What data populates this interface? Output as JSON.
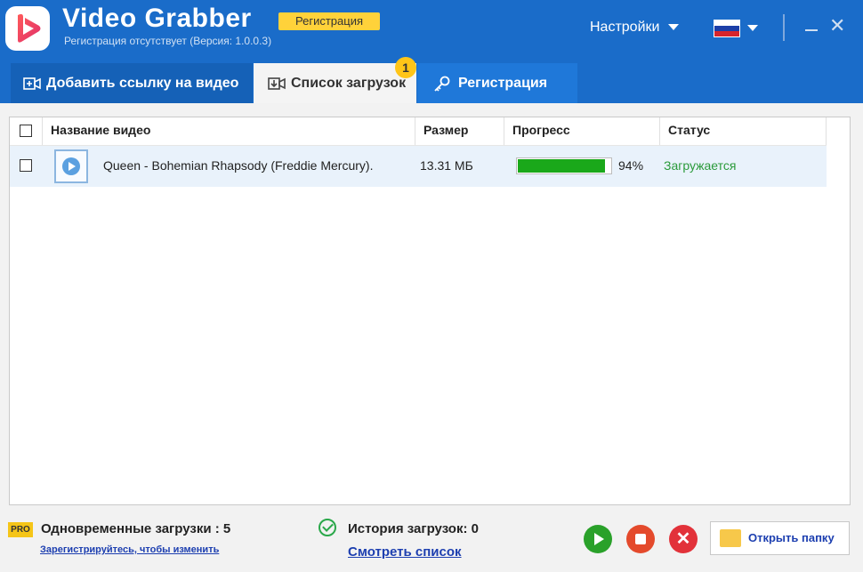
{
  "app": {
    "title": "Video Grabber",
    "registration_badge": "Регистрация",
    "subtitle": "Регистрация отсутствует (Версия: 1.0.0.3)"
  },
  "topbar": {
    "settings_label": "Настройки",
    "language_flag": "russia-flag-icon",
    "minimize": "minimize-icon",
    "close": "close-icon"
  },
  "tabs": [
    {
      "label": "Добавить ссылку на видео",
      "icon": "add-video-icon",
      "active": false
    },
    {
      "label": "Список загрузок",
      "icon": "download-list-icon",
      "active": true,
      "badge": "1"
    },
    {
      "label": "Регистрация",
      "icon": "key-icon",
      "active": false
    }
  ],
  "table": {
    "headers": {
      "name": "Название видео",
      "size": "Размер",
      "progress": "Прогресс",
      "status": "Статус"
    },
    "rows": [
      {
        "name": "Queen - Bohemian Rhapsody (Freddie Mercury).",
        "size": "13.31 МБ",
        "progress_percent": 94,
        "progress_label": "94%",
        "status": "Загружается"
      }
    ]
  },
  "footer": {
    "pro_badge": "PRO",
    "concurrent_label": "Одновременные загрузки : 5",
    "register_link": "Зарегистрируйтесь, чтобы изменить",
    "history_label": "История загрузок: 0",
    "view_list_link": "Смотреть список",
    "open_folder_label": "Открыть папку"
  },
  "colors": {
    "header_bg": "#1a6cc9",
    "badge_yellow": "#ffd23a",
    "progress_green": "#1aa81a",
    "status_green": "#2a9a3a",
    "link_blue": "#1d3fb0"
  }
}
